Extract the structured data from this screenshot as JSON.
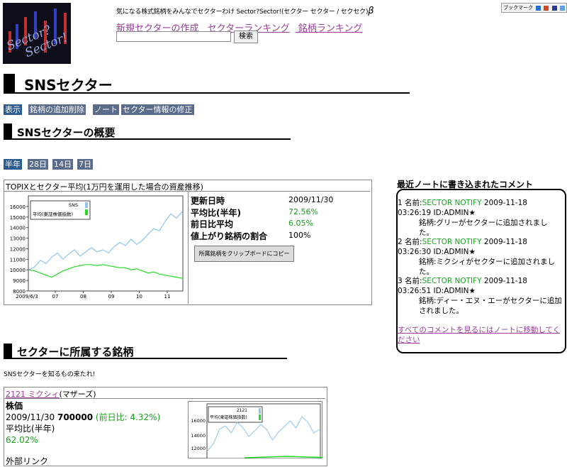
{
  "header": {
    "logo_text_1": "Sector?",
    "logo_text_2": "Sector!",
    "tagline": "気になる株式銘柄をみんなでセクターわけ  Sector?Sector!(セクター セクター / セクセク)",
    "tagline_beta": "β",
    "bookmark_label": "ブックマーク",
    "nav": [
      "新規セクターの作成",
      "セクターランキング",
      "銘柄ランキング"
    ],
    "search_value": "",
    "search_button": "検索"
  },
  "page": {
    "title": "SNSセクター",
    "tabs": [
      "表示",
      "銘柄の追加削除",
      "ノート",
      "セクター情報の修正"
    ],
    "overview_title": "SNSセクターの概要",
    "period_tabs": [
      "半年",
      "28日",
      "14日",
      "7日"
    ]
  },
  "chart_panel": {
    "title": "TOPIXとセクター平均(1万円を運用した場合の資産推移)",
    "stats": [
      {
        "label": "更新日時",
        "value": "2009/11/30"
      },
      {
        "label": "平均比(半年)",
        "value": "72.56%"
      },
      {
        "label": "前日比平均",
        "value": "6.05%"
      },
      {
        "label": "値上がり銘柄の割合",
        "value": "100%"
      }
    ],
    "copy_button": "所属銘柄をクリップボードにコピー"
  },
  "chart_data": {
    "type": "line",
    "x_start_label": "2009/6/3",
    "x_ticks": [
      "07",
      "08",
      "09",
      "10",
      "11"
    ],
    "yticks": [
      8000,
      9000,
      10000,
      11000,
      12000,
      13000,
      14000,
      15000,
      16000
    ],
    "ylim": [
      8000,
      17000
    ],
    "series": [
      {
        "name": "SNS",
        "color": "#8ec4ee",
        "values": [
          10000,
          10300,
          10900,
          10600,
          11200,
          11600,
          11000,
          11500,
          11900,
          11300,
          11700,
          12100,
          11700,
          11900,
          11600,
          12200,
          12600,
          12300,
          12900,
          12400,
          12800,
          13400,
          13900,
          13700,
          14600,
          15300,
          14900,
          15500
        ]
      },
      {
        "name": "平均(東証株価指数)",
        "color": "#22dd22",
        "values": [
          10000,
          9900,
          9700,
          9500,
          9300,
          9600,
          9900,
          10100,
          10300,
          10400,
          10500,
          10500,
          10400,
          10500,
          10400,
          10300,
          10200,
          10200,
          10000,
          10100,
          9900,
          9700,
          9800,
          9600,
          9500,
          9400,
          9300,
          9200
        ]
      }
    ],
    "legend": "top-left"
  },
  "comments": {
    "heading": "最近ノートに書き込まれたコメント",
    "items": [
      {
        "head": "1 名前:",
        "name": "SECTOR NOTIFY",
        "date": " 2009-11-18",
        "time_id": "03:26:19 ID:ADMIN★",
        "body": "銘柄:グリーがセクターに追加されました。"
      },
      {
        "head": "2 名前:",
        "name": "SECTOR NOTIFY",
        "date": " 2009-11-18",
        "time_id": "03:26:30 ID:ADMIN★",
        "body": "銘柄:ミクシィがセクターに追加されました。"
      },
      {
        "head": "3 名前:",
        "name": "SECTOR NOTIFY",
        "date": " 2009-11-18",
        "time_id": "03:26:51 ID:ADMIN★",
        "body": "銘柄:ディー・エヌ・エーがセクターに追加されました。"
      }
    ],
    "all_link": "すべてのコメントを見るにはノートに移動してください"
  },
  "stocks": {
    "title": "セクターに所属する銘柄",
    "subtitle": "SNSセクターを知るもの来たれ!",
    "items": [
      {
        "code_name": "2121   ミクシィ",
        "market": "(マザーズ)",
        "price_label": "株価",
        "price_date": "2009/11/30 ",
        "price": "700000",
        "change": " (前日比: 4.32%)",
        "avg_label": "平均比(半年)",
        "avg_value": "62.02%",
        "ext_label": "外部リンク",
        "chart_legend_1": "2121",
        "chart_legend_2": "平均(東証株価指数)",
        "chart_yticks": [
          "16000",
          "14000",
          "12000"
        ]
      }
    ]
  }
}
